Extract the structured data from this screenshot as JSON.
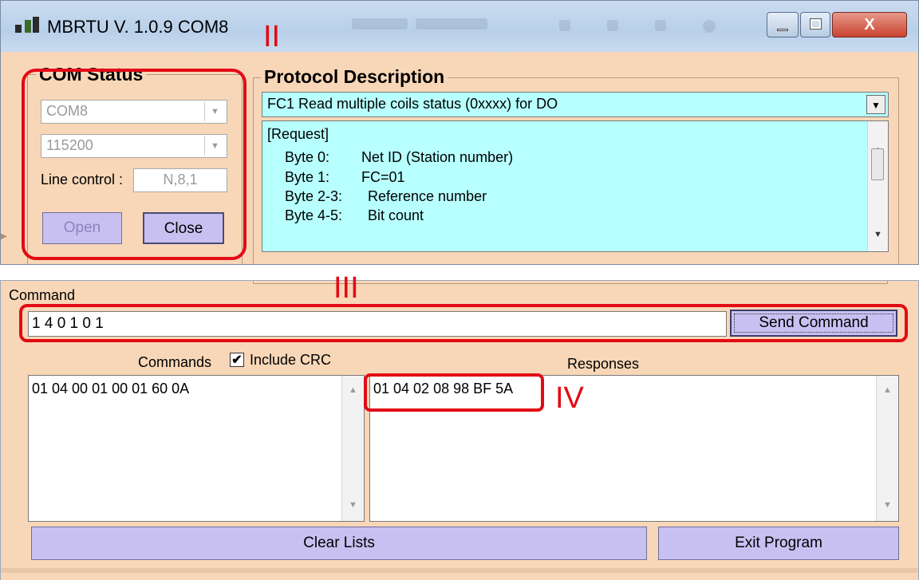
{
  "window": {
    "title": "MBRTU  V. 1.0.9  COM8",
    "controls": {
      "minimize": "–",
      "maximize": "□",
      "close": "X"
    }
  },
  "com_status": {
    "legend": "COM Status",
    "port": "COM8",
    "baud": "115200",
    "line_control_label": "Line control :",
    "line_control_value": "N,8,1",
    "open_label": "Open",
    "close_label": "Close"
  },
  "protocol": {
    "legend": "Protocol Description",
    "selected": "FC1  Read multiple coils status (0xxxx)  for DO",
    "request_header": "[Request]",
    "rows": [
      {
        "k": "Byte 0:",
        "v": "Net ID (Station number)"
      },
      {
        "k": "Byte 1:",
        "v": "FC=01"
      },
      {
        "k": "Byte 2-3:",
        "v": "Reference number"
      },
      {
        "k": "Byte 4-5:",
        "v": "Bit count"
      }
    ]
  },
  "command": {
    "label": "Command",
    "value": "1 4 0 1 0 1",
    "send_label": "Send Command"
  },
  "commands_list": {
    "label": "Commands",
    "include_crc_label": "Include CRC",
    "include_crc_checked": true,
    "items": [
      "01 04 00 01 00 01 60 0A"
    ]
  },
  "responses_list": {
    "label": "Responses",
    "items": [
      "01 04 02 08 98 BF 5A"
    ]
  },
  "footer": {
    "clear_label": "Clear Lists",
    "exit_label": "Exit Program"
  },
  "annotations": {
    "a2": "II",
    "a3": "III",
    "a4": "IV",
    "color": "#e20b14"
  }
}
